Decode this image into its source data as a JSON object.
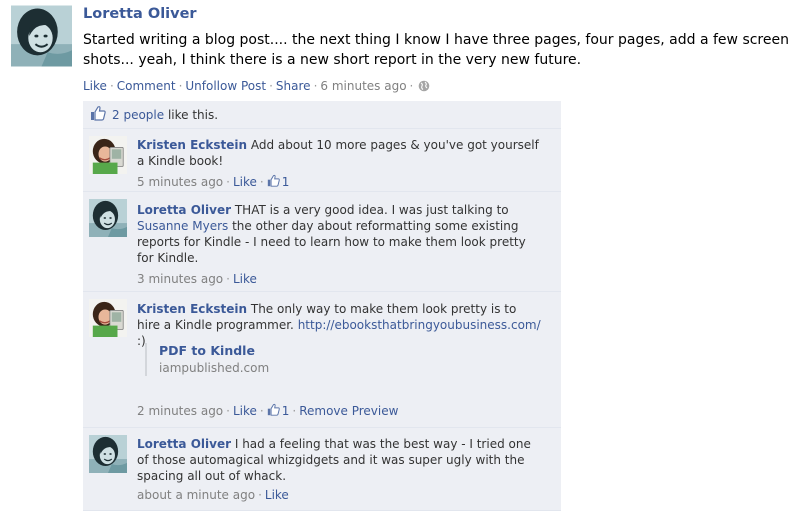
{
  "post": {
    "author": "Loretta Oliver",
    "text": "Started writing a blog post.... the next thing I know I have three pages, four pages, add a few screen shots... yeah, I think there is a new short report in the very new future.",
    "actions": {
      "like": "Like",
      "comment": "Comment",
      "unfollow": "Unfollow Post",
      "share": "Share",
      "time": "6 minutes ago"
    }
  },
  "likes": {
    "count_link": "2 people",
    "suffix": "like this."
  },
  "comments": [
    {
      "author": "Kristen Eckstein",
      "text": "Add about 10 more pages & you've got yourself a Kindle book!",
      "time": "5 minutes ago",
      "like": "Like",
      "like_count": "1"
    },
    {
      "author": "Loretta Oliver",
      "text_before": "THAT is a very good idea. I was just talking to",
      "mention": "Susanne Myers",
      "text_after": "the other day about reformatting some existing reports for Kindle - I need to learn how to make them look pretty for Kindle.",
      "time": "3 minutes ago",
      "like": "Like"
    },
    {
      "author": "Kristen Eckstein",
      "text_before": "The only way to make them look pretty is to hire a Kindle programmer.",
      "url": "http://ebooksthatbringyoubusiness.com/",
      "text_after": ":)",
      "preview_title": "PDF to Kindle",
      "preview_domain": "iampublished.com",
      "time": "2 minutes ago",
      "like": "Like",
      "like_count": "1",
      "remove_preview": "Remove Preview"
    },
    {
      "author": "Loretta Oliver",
      "text": "I had a feeling that was the best way - I tried one of those automagical whizgidgets and it was super ugly with the spacing all out of whack.",
      "time": "about a minute ago",
      "like": "Like"
    }
  ],
  "separator": "·",
  "colors": {
    "link": "#3b5998",
    "feedback_bg": "#edeff4",
    "meta": "#808080"
  },
  "icons": [
    "thumbs-up-icon",
    "globe-icon",
    "avatar-loretta",
    "avatar-kristen"
  ]
}
